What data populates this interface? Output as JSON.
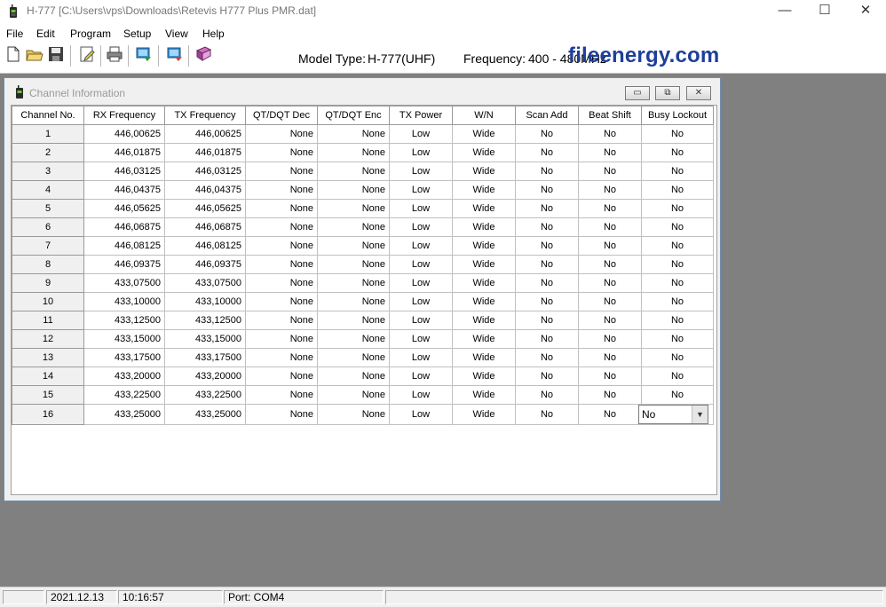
{
  "window": {
    "title": "H-777 [C:\\Users\\vps\\Downloads\\Retevis H777 Plus PMR.dat]",
    "minimize": "—",
    "maximize": "☐",
    "close": "✕"
  },
  "menu": [
    {
      "label": "File"
    },
    {
      "label": "Edit"
    },
    {
      "label": "Program"
    },
    {
      "label": "Setup"
    },
    {
      "label": "View"
    },
    {
      "label": "Help"
    }
  ],
  "header": {
    "model_label": "Model Type:",
    "model_value": "H-777(UHF)",
    "freq_label": "Frequency:",
    "freq_value": "400 - 480MHz"
  },
  "watermark": "fileenergy.com",
  "child": {
    "title": "Channel Information"
  },
  "table": {
    "columns": [
      "Channel No.",
      "RX Frequency",
      "TX Frequency",
      "QT/DQT Dec",
      "QT/DQT Enc",
      "TX Power",
      "W/N",
      "Scan Add",
      "Beat Shift",
      "Busy Lockout"
    ],
    "rows": [
      [
        "1",
        "446,00625",
        "446,00625",
        "None",
        "None",
        "Low",
        "Wide",
        "No",
        "No",
        "No"
      ],
      [
        "2",
        "446,01875",
        "446,01875",
        "None",
        "None",
        "Low",
        "Wide",
        "No",
        "No",
        "No"
      ],
      [
        "3",
        "446,03125",
        "446,03125",
        "None",
        "None",
        "Low",
        "Wide",
        "No",
        "No",
        "No"
      ],
      [
        "4",
        "446,04375",
        "446,04375",
        "None",
        "None",
        "Low",
        "Wide",
        "No",
        "No",
        "No"
      ],
      [
        "5",
        "446,05625",
        "446,05625",
        "None",
        "None",
        "Low",
        "Wide",
        "No",
        "No",
        "No"
      ],
      [
        "6",
        "446,06875",
        "446,06875",
        "None",
        "None",
        "Low",
        "Wide",
        "No",
        "No",
        "No"
      ],
      [
        "7",
        "446,08125",
        "446,08125",
        "None",
        "None",
        "Low",
        "Wide",
        "No",
        "No",
        "No"
      ],
      [
        "8",
        "446,09375",
        "446,09375",
        "None",
        "None",
        "Low",
        "Wide",
        "No",
        "No",
        "No"
      ],
      [
        "9",
        "433,07500",
        "433,07500",
        "None",
        "None",
        "Low",
        "Wide",
        "No",
        "No",
        "No"
      ],
      [
        "10",
        "433,10000",
        "433,10000",
        "None",
        "None",
        "Low",
        "Wide",
        "No",
        "No",
        "No"
      ],
      [
        "11",
        "433,12500",
        "433,12500",
        "None",
        "None",
        "Low",
        "Wide",
        "No",
        "No",
        "No"
      ],
      [
        "12",
        "433,15000",
        "433,15000",
        "None",
        "None",
        "Low",
        "Wide",
        "No",
        "No",
        "No"
      ],
      [
        "13",
        "433,17500",
        "433,17500",
        "None",
        "None",
        "Low",
        "Wide",
        "No",
        "No",
        "No"
      ],
      [
        "14",
        "433,20000",
        "433,20000",
        "None",
        "None",
        "Low",
        "Wide",
        "No",
        "No",
        "No"
      ],
      [
        "15",
        "433,22500",
        "433,22500",
        "None",
        "None",
        "Low",
        "Wide",
        "No",
        "No",
        "No"
      ],
      [
        "16",
        "433,25000",
        "433,25000",
        "None",
        "None",
        "Low",
        "Wide",
        "No",
        "No",
        "No"
      ]
    ]
  },
  "status": {
    "date": "2021.12.13",
    "time": "10:16:57",
    "port": "Port: COM4"
  },
  "colors": {
    "workspace": "#808080",
    "watermark": "#1e3f9a",
    "child_border": "#6d8fb3"
  }
}
